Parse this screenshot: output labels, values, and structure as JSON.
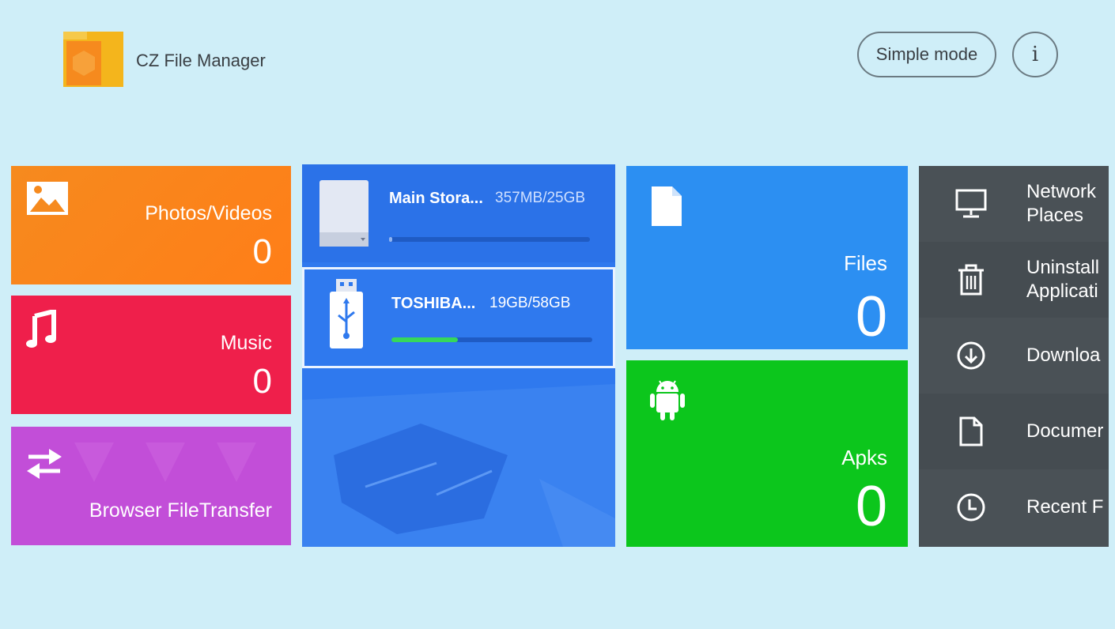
{
  "header": {
    "app_title": "CZ File Manager",
    "simple_mode_label": "Simple mode",
    "info_label": "i"
  },
  "tiles": {
    "photos": {
      "label": "Photos/Videos",
      "count": "0",
      "icon": "image-icon"
    },
    "music": {
      "label": "Music",
      "count": "0",
      "icon": "music-note-icon"
    },
    "browser": {
      "label": "Browser FileTransfer",
      "icon": "transfer-arrows-icon"
    },
    "files": {
      "label": "Files",
      "count": "0",
      "icon": "file-icon"
    },
    "apks": {
      "label": "Apks",
      "count": "0",
      "icon": "android-icon"
    }
  },
  "storage": {
    "main": {
      "name": "Main Stora...",
      "size": "357MB/25GB",
      "usage": 0.014,
      "icon": "drive-icon"
    },
    "usb": {
      "name": "TOSHIBA...",
      "size": "19GB/58GB",
      "usage": 0.33,
      "icon": "usb-icon"
    }
  },
  "sidebar": {
    "items": [
      {
        "label_line1": "Network",
        "label_line2": "Places",
        "icon": "monitor-icon"
      },
      {
        "label_line1": "Uninstall",
        "label_line2": "Applicati",
        "icon": "trash-icon"
      },
      {
        "label_line1": "Downloa",
        "icon": "download-icon"
      },
      {
        "label_line1": "Documer",
        "icon": "document-icon"
      },
      {
        "label_line1": "Recent F",
        "icon": "clock-icon"
      }
    ]
  },
  "colors": {
    "background": "#cfeef8",
    "photos": "#f68a1e",
    "music": "#ef1f4b",
    "browser": "#c24ed8",
    "storage": "#2f79ee",
    "files": "#2c8ff2",
    "apks": "#0cc61c",
    "sidebar": "#4a5156",
    "usb_bar": "#36d85a"
  }
}
